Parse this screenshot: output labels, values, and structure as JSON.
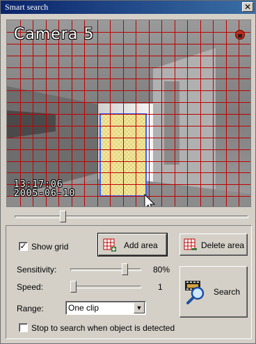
{
  "window": {
    "title": "Smart search",
    "close_glyph": "✕"
  },
  "video": {
    "camera_label": "Camera 5",
    "time": "13:17:06",
    "date": "2005-06-10",
    "grid_color": "#c00000",
    "selection_color": "#3366ff",
    "record_icon": "record-icon"
  },
  "playback": {
    "seek_fraction": 0.2
  },
  "controls": {
    "show_grid": {
      "label": "Show grid",
      "checked": true,
      "mark": "✓"
    },
    "add_area": {
      "label": "Add area",
      "icon": "add-area-grid-icon"
    },
    "delete_area": {
      "label": "Delete area",
      "icon": "delete-area-grid-icon"
    },
    "sensitivity": {
      "label": "Sensitivity:",
      "value_text": "80%",
      "value": 80,
      "max": 100
    },
    "speed": {
      "label": "Speed:",
      "value_text": "1",
      "value": 1,
      "max": 10
    },
    "range": {
      "label": "Range:",
      "selected": "One clip"
    },
    "search": {
      "label": "Search",
      "icon": "search-film-magnifier-icon"
    },
    "stop_on_detect": {
      "label": "Stop to search when object is detected",
      "checked": false
    }
  }
}
